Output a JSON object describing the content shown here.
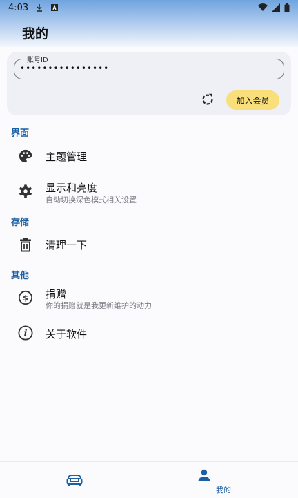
{
  "status_bar": {
    "time": "4:03",
    "icons": [
      "download-icon",
      "a-icon",
      "wifi-icon",
      "signal-icon",
      "battery-icon"
    ]
  },
  "page": {
    "title": "我的"
  },
  "account": {
    "label": "账号ID",
    "value": "••••••••••••••••",
    "join_label": "加入会员"
  },
  "sections": {
    "interface": {
      "title": "界面",
      "items": [
        {
          "title": "主题管理",
          "subtitle": ""
        },
        {
          "title": "显示和亮度",
          "subtitle": "自动切换深色模式相关设置"
        }
      ]
    },
    "storage": {
      "title": "存储",
      "items": [
        {
          "title": "清理一下",
          "subtitle": ""
        }
      ]
    },
    "other": {
      "title": "其他",
      "items": [
        {
          "title": "捐赠",
          "subtitle": "你的捐赠就是我更新维护的动力"
        },
        {
          "title": "关于软件",
          "subtitle": ""
        }
      ]
    }
  },
  "bottom_nav": {
    "items": [
      {
        "icon": "home-sofa-icon",
        "label": ""
      },
      {
        "icon": "person-icon",
        "label": "我的"
      }
    ]
  },
  "colors": {
    "accent": "#1d5fa5",
    "join_button": "#f8df79",
    "card": "#efeff6"
  }
}
